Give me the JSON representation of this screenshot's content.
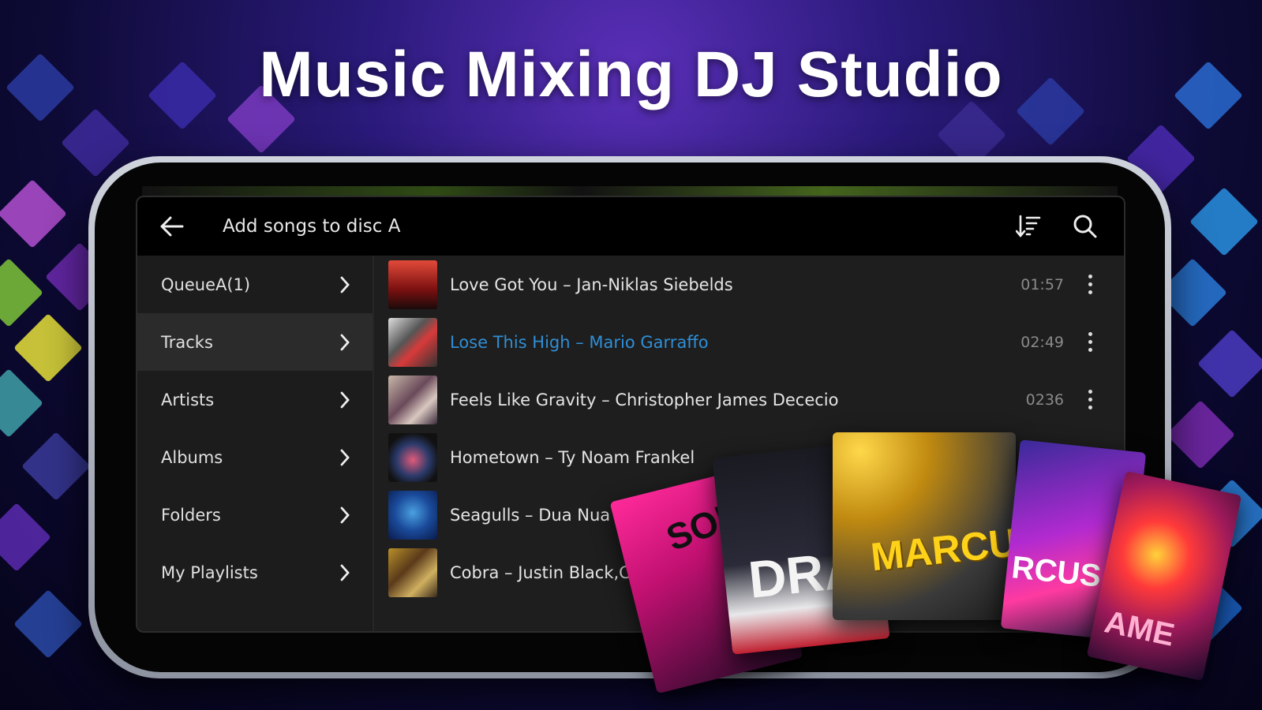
{
  "headline": "Music Mixing DJ Studio",
  "dialog": {
    "title": "Add songs to disc A",
    "back_icon": "arrow-left-icon",
    "sort_icon": "sort-icon",
    "search_icon": "search-icon"
  },
  "sidebar": {
    "items": [
      {
        "label": "QueueA(1)",
        "active": false
      },
      {
        "label": "Tracks",
        "active": true
      },
      {
        "label": "Artists",
        "active": false
      },
      {
        "label": "Albums",
        "active": false
      },
      {
        "label": "Folders",
        "active": false
      },
      {
        "label": "My Playlists",
        "active": false
      }
    ]
  },
  "tracks": [
    {
      "title": "Love Got You – Jan-Niklas Siebelds",
      "duration": "01:57",
      "playing": false
    },
    {
      "title": "Lose This High – Mario Garraffo",
      "duration": "02:49",
      "playing": true
    },
    {
      "title": "Feels Like Gravity – Christopher James Dececio",
      "duration": "0236",
      "playing": false
    },
    {
      "title": "Hometown – Ty Noam Frankel",
      "duration": "",
      "playing": false
    },
    {
      "title": "Seagulls – Dua Nua",
      "duration": "",
      "playing": false
    },
    {
      "title": "Cobra – Justin Black,C",
      "duration": "",
      "playing": false
    }
  ],
  "covers": {
    "c1": "SON",
    "c2": "DRA",
    "c3": "MARCUS",
    "c4": "RCUS",
    "c5": "AME"
  },
  "colors": {
    "accent": "#2f8fd6",
    "background": "#1e1e1e"
  }
}
